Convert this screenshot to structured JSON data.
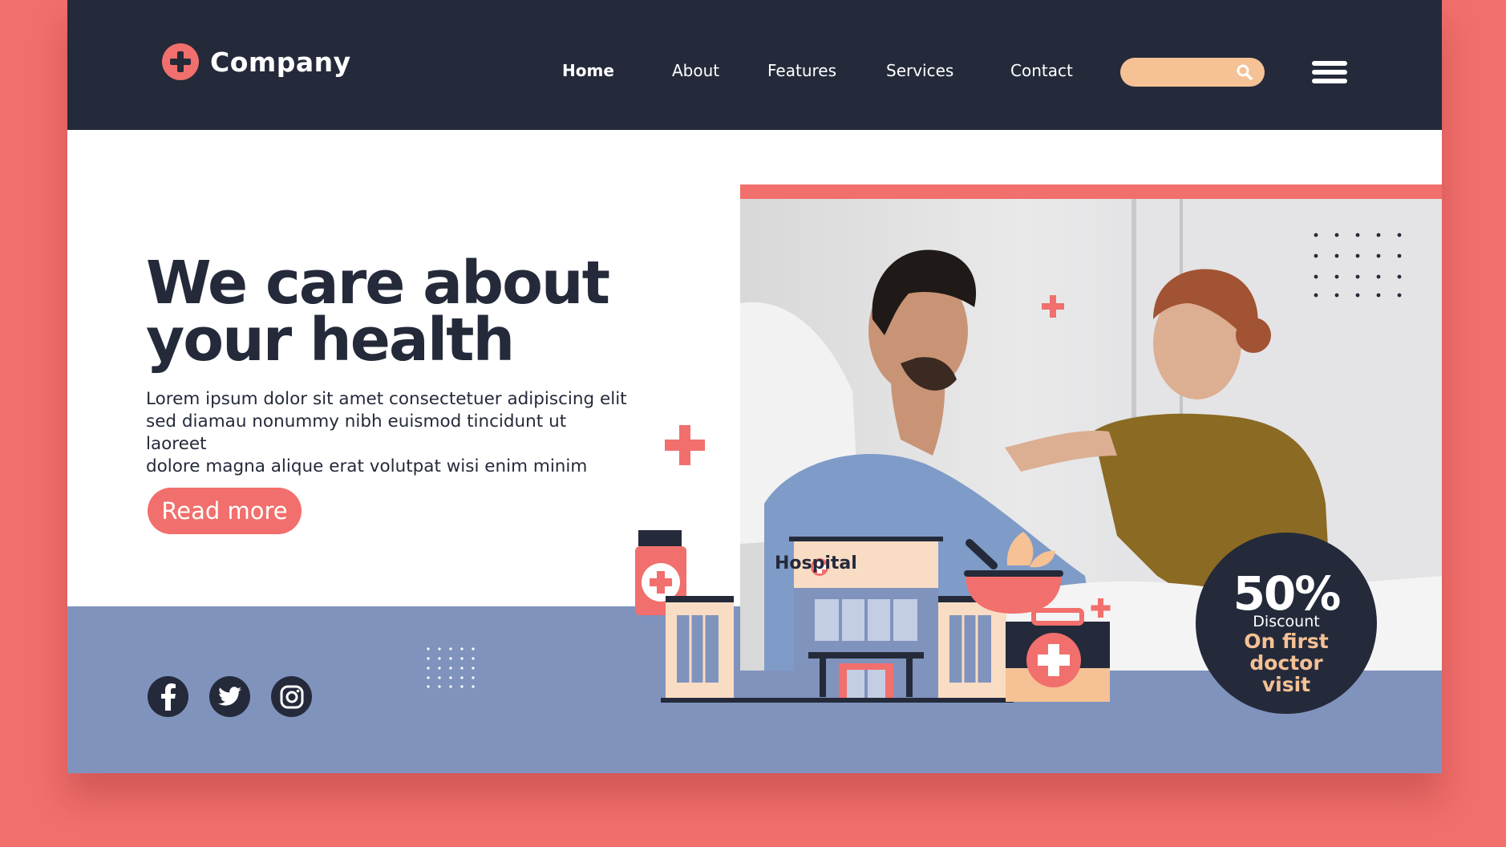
{
  "brand": {
    "name": "Company",
    "logo_icon": "medical-cross-icon"
  },
  "nav": {
    "items": [
      {
        "label": "Home",
        "active": true
      },
      {
        "label": "About",
        "active": false
      },
      {
        "label": "Features",
        "active": false
      },
      {
        "label": "Services",
        "active": false
      },
      {
        "label": "Contact",
        "active": false
      }
    ],
    "search_icon": "search-icon",
    "menu_icon": "hamburger-menu-icon"
  },
  "hero": {
    "headline_line1": "We care about",
    "headline_line2": "your health",
    "body_line1": "Lorem ipsum dolor sit amet consectetuer adipiscing elit",
    "body_line2": "sed diamau nonummy nibh euismod tincidunt ut laoreet",
    "body_line3": "dolore magna alique erat volutpat wisi enim minim",
    "cta_label": "Read more"
  },
  "illustration": {
    "hospital_label": "Hospital"
  },
  "promo": {
    "percent": "50%",
    "label": "Discount",
    "line1": "On first",
    "line2": "doctor",
    "line3": "visit"
  },
  "social": [
    "facebook-icon",
    "twitter-icon",
    "instagram-icon"
  ],
  "colors": {
    "background": "#F16F6C",
    "nav": "#242A3A",
    "accent": "#F16F6C",
    "search": "#F5C195",
    "band": "#8093BD"
  }
}
